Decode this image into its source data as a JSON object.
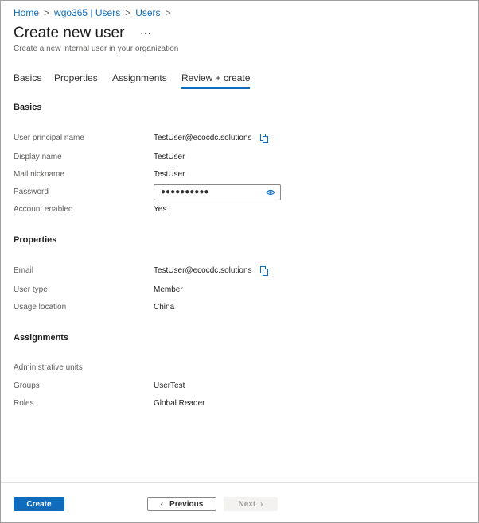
{
  "breadcrumb": [
    "Home",
    "wgo365 | Users",
    "Users"
  ],
  "header": {
    "title": "Create new user",
    "more": "···",
    "subtitle": "Create a new internal user in your organization"
  },
  "tabs": [
    "Basics",
    "Properties",
    "Assignments",
    "Review + create"
  ],
  "basics": {
    "heading": "Basics",
    "rows": [
      {
        "label": "User principal name",
        "value": "TestUser@ecocdc.solutions"
      },
      {
        "label": "Display name",
        "value": "TestUser"
      },
      {
        "label": "Mail nickname",
        "value": "TestUser"
      },
      {
        "label": "Password",
        "value": "●●●●●●●●●●"
      },
      {
        "label": "Account enabled",
        "value": "Yes"
      }
    ]
  },
  "properties": {
    "heading": "Properties",
    "rows": [
      {
        "label": "Email",
        "value": "TestUser@ecocdc.solutions"
      },
      {
        "label": "User type",
        "value": "Member"
      },
      {
        "label": "Usage location",
        "value": "China"
      }
    ]
  },
  "assignments": {
    "heading": "Assignments",
    "rows": [
      {
        "label": "Administrative units",
        "value": ""
      },
      {
        "label": "Groups",
        "value": "UserTest"
      },
      {
        "label": "Roles",
        "value": "Global Reader"
      }
    ]
  },
  "footer": {
    "create": "Create",
    "previous": "Previous",
    "next": "Next"
  },
  "colors": {
    "accent": "#0f6cbd"
  }
}
